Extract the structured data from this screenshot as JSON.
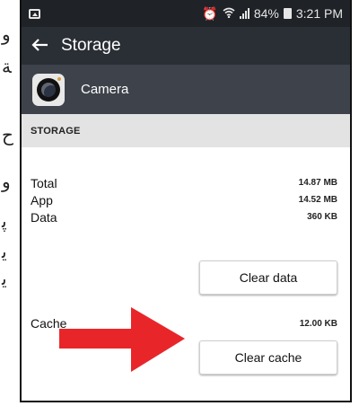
{
  "status_bar": {
    "notification_icon": "image-icon",
    "icons": [
      "alarm-clock-icon",
      "wifi-icon",
      "signal-icon"
    ],
    "battery_percent": "84%",
    "time": "3:21 PM"
  },
  "toolbar": {
    "back_icon": "back-arrow-icon",
    "title": "Storage"
  },
  "app": {
    "name": "Camera",
    "icon": "camera-icon"
  },
  "section": {
    "header": "STORAGE"
  },
  "storage": {
    "rows": [
      {
        "label": "Total",
        "value": "14.87 MB"
      },
      {
        "label": "App",
        "value": "14.52 MB"
      },
      {
        "label": "Data",
        "value": "360 KB"
      }
    ],
    "clear_data_label": "Clear data",
    "cache_label": "Cache",
    "cache_value": "12.00 KB",
    "clear_cache_label": "Clear cache"
  },
  "annotation": {
    "arrow_color": "#e8262a",
    "arrow_icon": "red-arrow-icon"
  },
  "colors": {
    "status_bar": "#1f2227",
    "toolbar": "#2a2e35",
    "app_row": "#3e434b",
    "section_header": "#e3e3e3"
  }
}
